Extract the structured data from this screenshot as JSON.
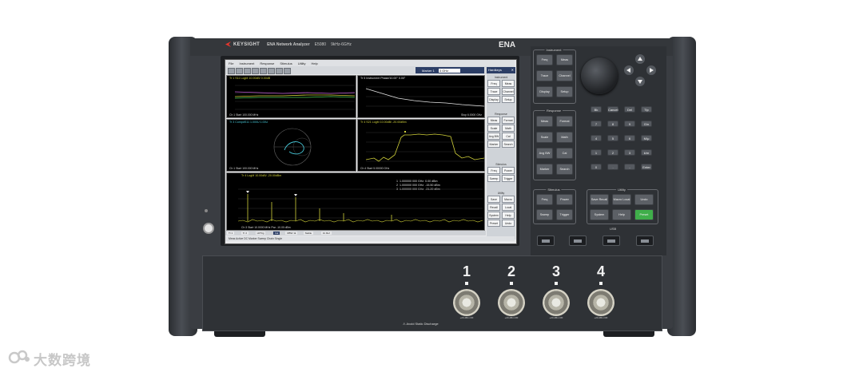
{
  "device": {
    "brand": "KEYSIGHT",
    "model_title": "ENA Network Analyzer",
    "model_number": "E5080",
    "freq_range": "9kHz-6GHz",
    "series": "ENA"
  },
  "screen": {
    "menu": [
      "File",
      "Instrument",
      "Response",
      "Stimulus",
      "Utility",
      "Help"
    ],
    "marker": {
      "label": "Marker 1",
      "value": "3 GHz"
    },
    "softkeys": {
      "hardkeys_title": "Hardkeys",
      "groups": [
        {
          "title": "Instrument",
          "keys": [
            "Freq",
            "Meas",
            "Trace",
            "Channel",
            "Display",
            "Setup"
          ]
        },
        {
          "title": "Response",
          "keys": [
            "Meas",
            "Format",
            "Scale",
            "Math",
            "Avg BW",
            "Cal",
            "Marker",
            "Search"
          ]
        },
        {
          "title": "Stimulus",
          "keys": [
            "Freq",
            "Power",
            "Sweep",
            "Trigger"
          ]
        },
        {
          "title": "Utility",
          "keys": [
            "Save",
            "Macro",
            "Recall",
            "Local",
            "System",
            "Help",
            "Preset",
            "Undo"
          ]
        }
      ]
    },
    "plots": [
      {
        "title": "Tr 1 S11 LogM 10.00dB/ 0.00dB",
        "footer": "Ch 1 Start 100.000 MHz",
        "footer_right": "Stop 6.0000 GHz",
        "color": "#d1d13a"
      },
      {
        "title": "Tr 5 Instrument Phase/10.00° 0.00°",
        "footer": "Ch 1 Start 100.000 MHz",
        "footer_right": "Stop 6.0000 GHz",
        "color": "#e6e6e6"
      },
      {
        "title": "Tr 3 CompdS11 1.000U 1.00U",
        "footer": "Ch 1 Start 100.000 MHz",
        "footer_right": "Stop 6.0000 GHz",
        "color": "#47c9d9"
      },
      {
        "title": "Tr 4 S21 LogM 10.00dB/ -20.00dBm",
        "footer": "Ch 4 Start 5.00000 GHz",
        "footer_right": "Stop 20.000 GHz",
        "color": "#d1d13a"
      },
      {
        "title": "Tr 4 LogM 10.00dB/ -20.00dBm",
        "footer": "Ch 3 Start 10.0000 MHz Pwr -10.00 dBm",
        "footer_right": "Stop 10.0000 GHz",
        "color": "#d1d13a"
      }
    ],
    "marker_table": [
      {
        "id": "1",
        "freq": "1.000000 000 GHz",
        "value": "0.00 dBm"
      },
      {
        "id": "2",
        "freq": "1.000000 000 GHz",
        "value": "-15.50 dBm"
      },
      {
        "id": "3",
        "freq": "1.000000 000 GHz",
        "value": "-21.20 dBm"
      }
    ],
    "status_tabs": [
      "Tr 1",
      "Tr 2",
      "LRTrig",
      "Cal",
      "RBW 1k",
      "Stable",
      "Int Ref"
    ],
    "status_line": "Meas Active  DC  Marker  Sweep Chain Single"
  },
  "keypad": {
    "instrument_label": "Instrument",
    "instrument_keys": [
      "Freq",
      "Meas",
      "Trace",
      "Channel",
      "Display",
      "Setup"
    ],
    "response_label": "Response",
    "response_keys": [
      "Meas",
      "Format",
      "Scale",
      "Math",
      "Avg BW",
      "Cal",
      "Marker",
      "Search"
    ],
    "stimulus_label": "Stimulus",
    "stimulus_keys": [
      "Freq",
      "Power",
      "Sweep",
      "Trigger"
    ],
    "utility_label": "Utility",
    "utility_keys": [
      "Save Recall",
      "Macro Local",
      "Undo",
      "System",
      "Help",
      "Preset"
    ],
    "numeric_keys": [
      "Bk",
      "Cancel",
      "Del",
      "Tip",
      "7",
      "8",
      "9",
      "G/n",
      "4",
      "5",
      "6",
      "M/μ",
      "1",
      "2",
      "3",
      "k/m",
      "0",
      ".",
      "-",
      "Enter"
    ],
    "usb_label": "USB"
  },
  "ports": {
    "labels": [
      "1",
      "2",
      "3",
      "4"
    ],
    "spec": "+20 dBm RF",
    "esd_warning": "Avoid Static Discharge"
  },
  "watermark": {
    "text": "大数跨境"
  },
  "colors": {
    "trace_yellow": "#d1d13a",
    "trace_cyan": "#47c9d9",
    "trace_green": "#4dcc55",
    "preset_key": "#3fae4a",
    "marker_bar": "#2c3e66"
  }
}
